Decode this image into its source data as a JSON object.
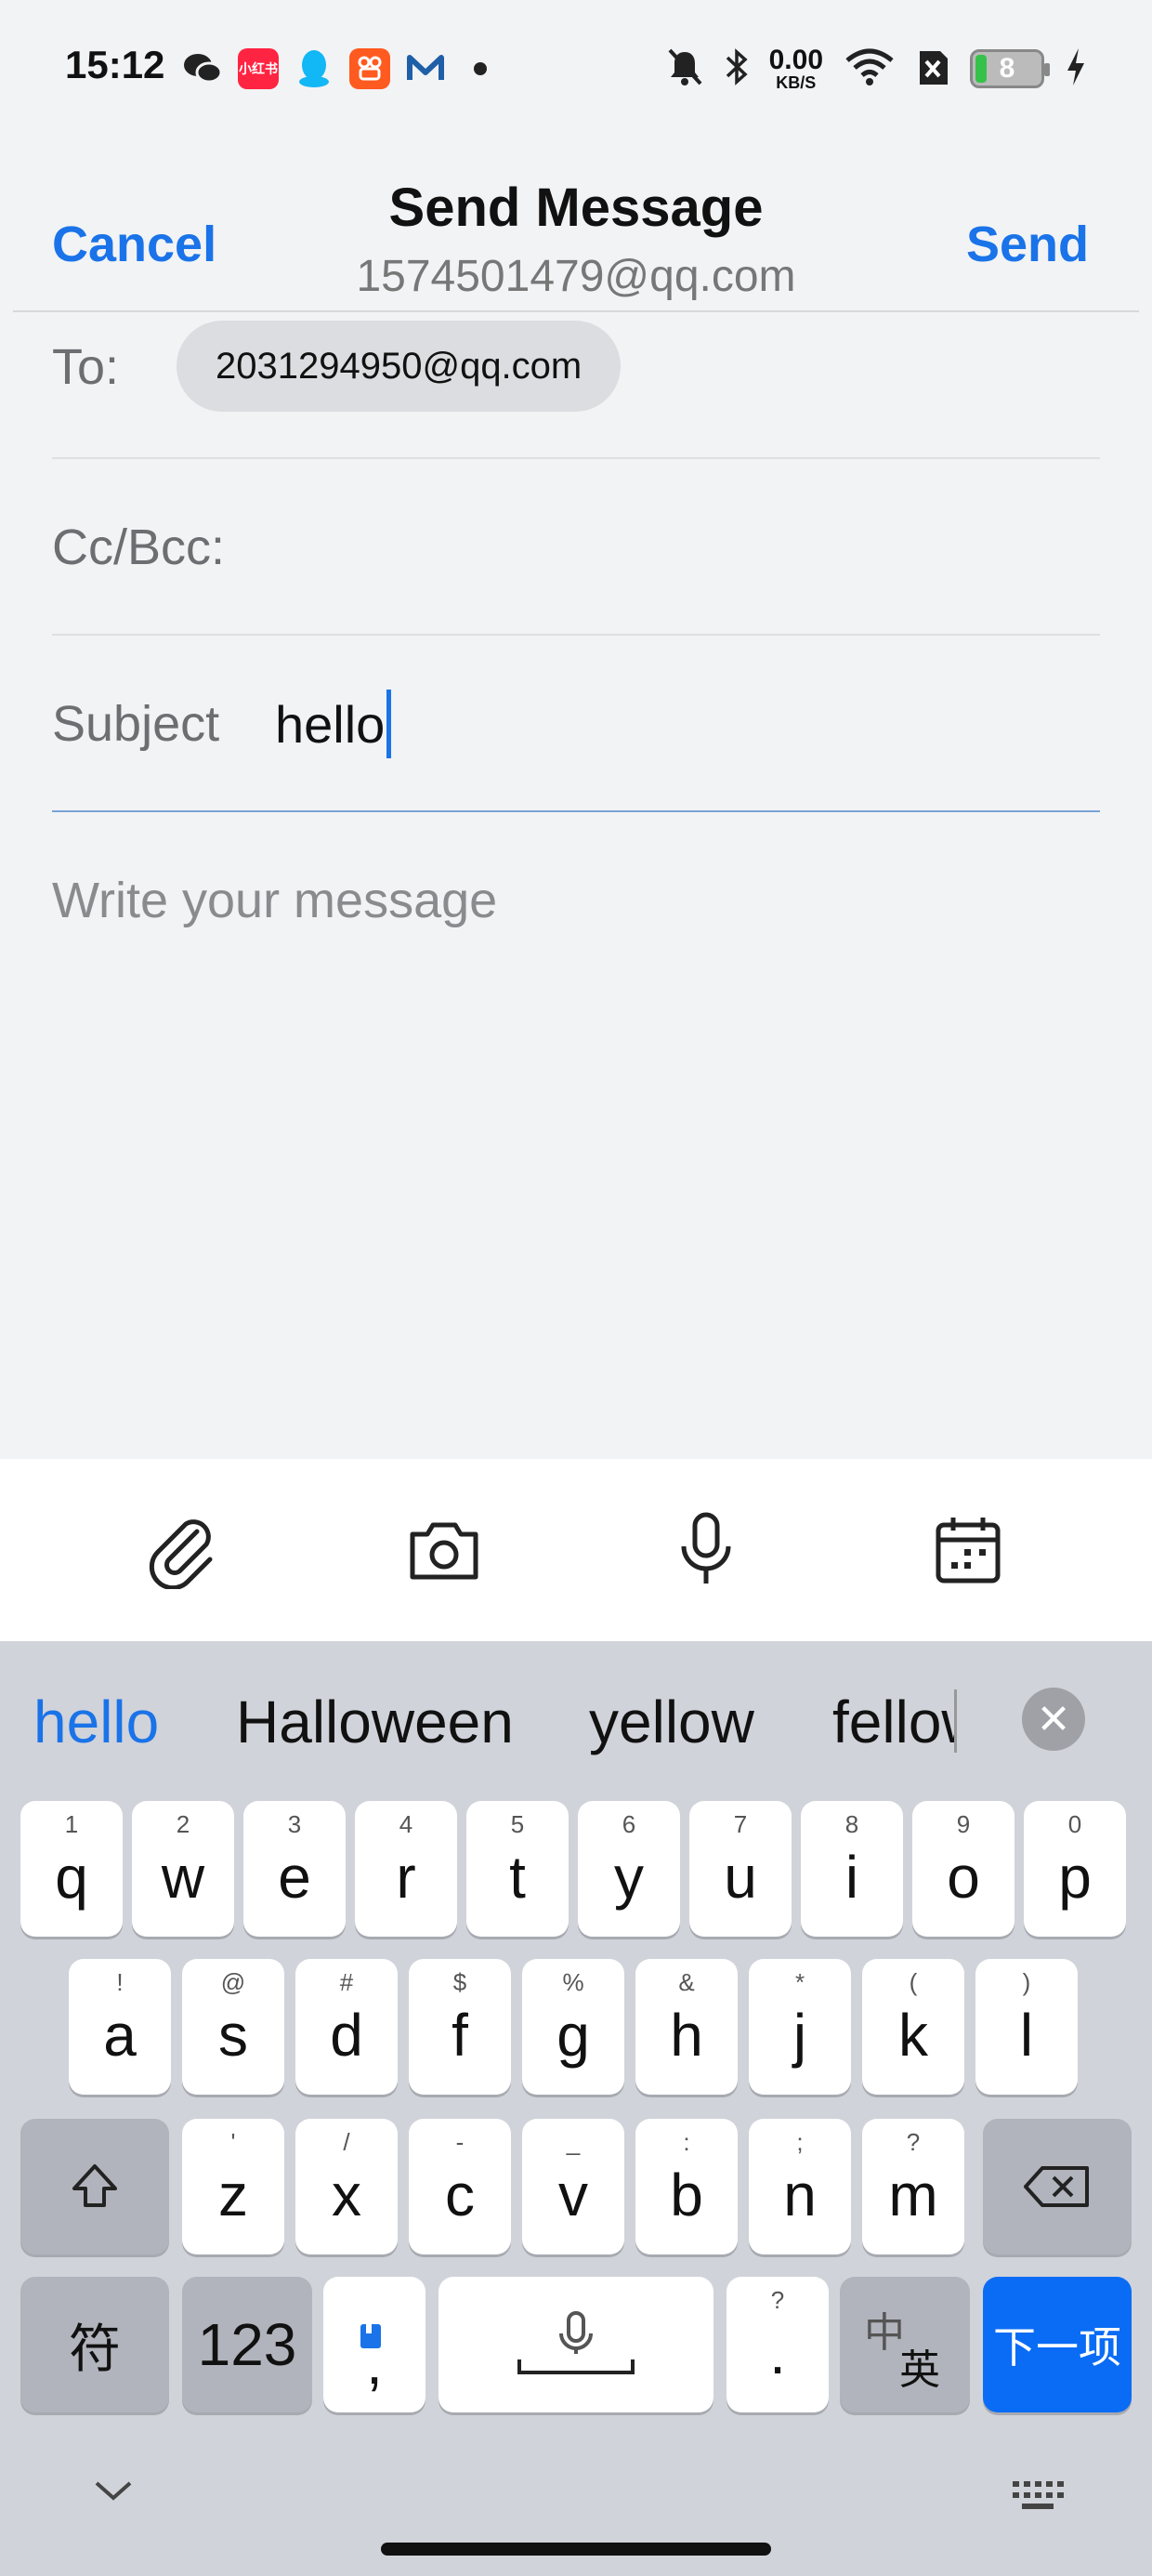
{
  "status_bar": {
    "time": "15:12",
    "apps": [
      {
        "name": "wechat-icon",
        "color": "#222222",
        "label": ""
      },
      {
        "name": "xiaohongshu-icon",
        "color": "#ff2442",
        "label": "小红书"
      },
      {
        "name": "qq-icon",
        "color": "#12b7f5",
        "label": ""
      },
      {
        "name": "kuaishou-icon",
        "color": "#ff5a1f",
        "label": ""
      },
      {
        "name": "mail-app-icon",
        "color": "#ffffff",
        "label": "M"
      }
    ],
    "net_speed_value": "0.00",
    "net_speed_unit": "KB/S",
    "battery_level": "8"
  },
  "header": {
    "cancel_label": "Cancel",
    "title": "Send Message",
    "subtitle": "1574501479@qq.com",
    "send_label": "Send",
    "accent_color": "#1a73e8"
  },
  "form": {
    "to_label": "To:",
    "to_recipient": "2031294950@qq.com",
    "cc_label": "Cc/Bcc:",
    "subject_label": "Subject",
    "subject_value": "hello",
    "body_placeholder": "Write your message"
  },
  "toolbar": {
    "icons": [
      "paperclip-icon",
      "camera-icon",
      "microphone-icon",
      "calendar-icon"
    ]
  },
  "keyboard": {
    "suggestions": [
      "hello",
      "Halloween",
      "yellow",
      "fellow"
    ],
    "row1": [
      {
        "hint": "1",
        "key": "q"
      },
      {
        "hint": "2",
        "key": "w"
      },
      {
        "hint": "3",
        "key": "e"
      },
      {
        "hint": "4",
        "key": "r"
      },
      {
        "hint": "5",
        "key": "t"
      },
      {
        "hint": "6",
        "key": "y"
      },
      {
        "hint": "7",
        "key": "u"
      },
      {
        "hint": "8",
        "key": "i"
      },
      {
        "hint": "9",
        "key": "o"
      },
      {
        "hint": "0",
        "key": "p"
      }
    ],
    "row2": [
      {
        "hint": "!",
        "key": "a"
      },
      {
        "hint": "@",
        "key": "s"
      },
      {
        "hint": "#",
        "key": "d"
      },
      {
        "hint": "$",
        "key": "f"
      },
      {
        "hint": "%",
        "key": "g"
      },
      {
        "hint": "&",
        "key": "h"
      },
      {
        "hint": "*",
        "key": "j"
      },
      {
        "hint": "(",
        "key": "k"
      },
      {
        "hint": ")",
        "key": "l"
      }
    ],
    "row3": [
      {
        "hint": "'",
        "key": "z"
      },
      {
        "hint": "/",
        "key": "x"
      },
      {
        "hint": "-",
        "key": "c"
      },
      {
        "hint": "_",
        "key": "v"
      },
      {
        "hint": ":",
        "key": "b"
      },
      {
        "hint": ";",
        "key": "n"
      },
      {
        "hint": "?",
        "key": "m"
      }
    ],
    "symbol_key": "符",
    "numbers_key": "123",
    "comma_key": ",",
    "period_key": ".",
    "period_hint": "?",
    "lang_key_top": "中",
    "lang_key_bottom": "英",
    "next_key": "下一项",
    "next_key_color": "#0a6cf5"
  }
}
